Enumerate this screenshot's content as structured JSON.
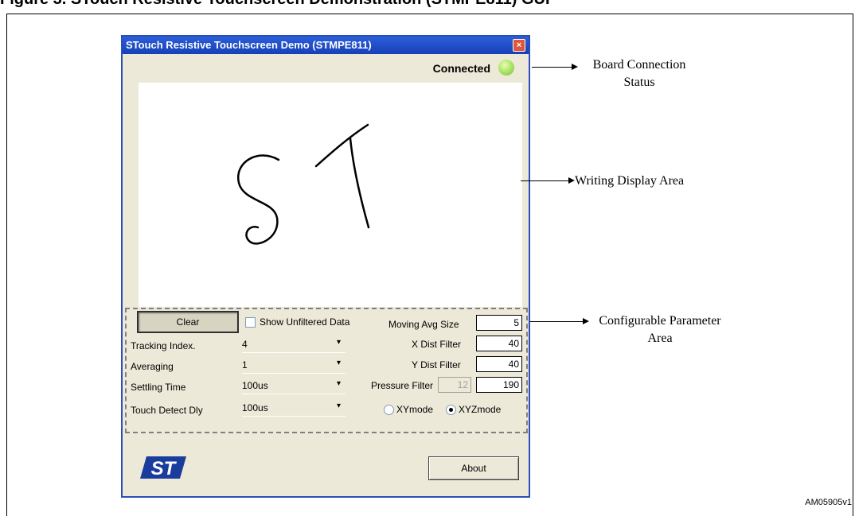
{
  "figure": {
    "header_partial": "Figure 3.   STouch Resistive Touchscreen Demonstration (STMPE811) GUI",
    "code": "AM05905v1"
  },
  "window": {
    "title": "STouch Resistive Touchscreen Demo (STMPE811)",
    "close_glyph": "×",
    "status": "Connected",
    "status_color": "#a5e060"
  },
  "controls": {
    "clear_label": "Clear",
    "show_unfiltered_label": "Show Unfiltered Data",
    "show_unfiltered_checked": false,
    "moving_avg_label": "Moving Avg Size",
    "moving_avg_value": "5",
    "tracking_index_label": "Tracking Index.",
    "tracking_index_value": "4",
    "averaging_label": "Averaging",
    "averaging_value": "1",
    "settling_time_label": "Settling Time",
    "settling_time_value": "100us",
    "touch_detect_label": "Touch Detect Dly",
    "touch_detect_value": "100us",
    "x_dist_label": "X Dist Filter",
    "x_dist_value": "40",
    "y_dist_label": "Y Dist Filter",
    "y_dist_value": "40",
    "pressure_label": "Pressure Filter",
    "pressure_disabled_value": "12",
    "pressure_value": "190",
    "xy_mode_label": "XYmode",
    "xyz_mode_label": "XYZmode",
    "selected_mode": "XYZmode",
    "about_label": "About",
    "dropdown_glyph": "▾"
  },
  "callouts": {
    "board_status": [
      "Board Connection",
      "Status"
    ],
    "writing_area": "Writing Display Area",
    "param_area": [
      "Configurable Parameter",
      "Area"
    ]
  },
  "logo": {
    "text": "ST",
    "color": "#1a3c9c"
  }
}
